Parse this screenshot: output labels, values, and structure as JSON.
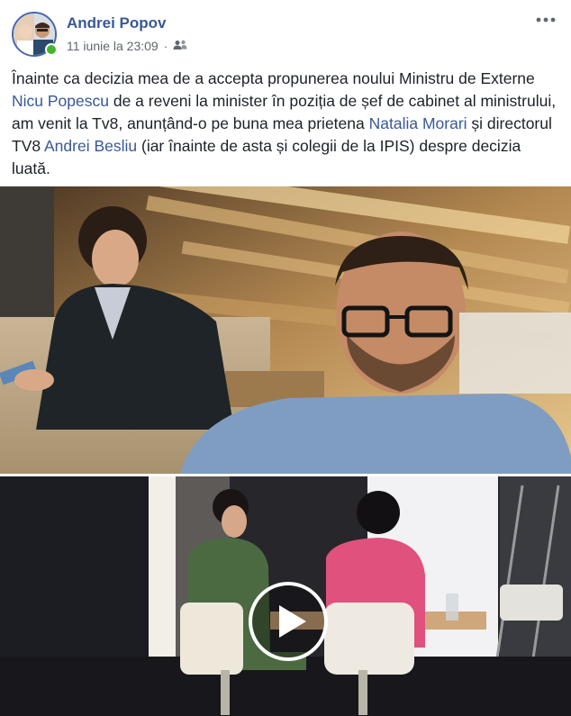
{
  "post": {
    "author": "Andrei Popov",
    "timestamp": "11 iunie la 23:09",
    "separator": "·",
    "audience_icon": "friends-icon",
    "more_icon": "more-options-icon",
    "text_parts": [
      "Înainte ca decizia mea de a accepta propunerea noului Ministru de Externe ",
      "Nicu Popescu",
      " de a reveni la minister în poziția de șef de cabinet al ministrului, am venit la Tv8, anunțând-o pe buna mea prietena ",
      "Natalia Morari",
      " și directorul TV8 ",
      "Andrei Besliu",
      " (iar înainte de asta și colegii de la IPIS) despre decizia luată."
    ]
  },
  "media": {
    "photo_1": "selfie-photo",
    "photo_2": "studio-video",
    "play_icon": "play-icon"
  },
  "colors": {
    "link": "#385898",
    "online": "#42b72a",
    "meta": "#616770"
  }
}
